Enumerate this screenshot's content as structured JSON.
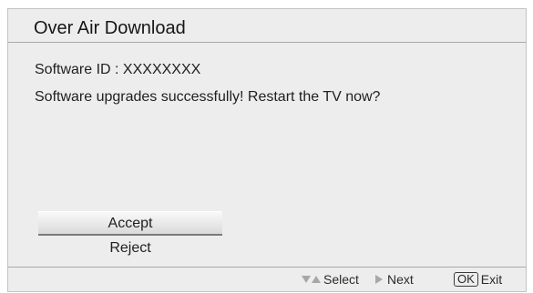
{
  "dialog": {
    "title": "Over Air Download",
    "software_id": "Software ID : XXXXXXXX",
    "message": "Software upgrades successfully! Restart the TV now?"
  },
  "buttons": {
    "accept_label": "Accept",
    "reject_label": "Reject",
    "selected": "Accept"
  },
  "footer": {
    "select_label": "Select",
    "next_label": "Next",
    "ok_key": "OK",
    "exit_label": "Exit",
    "icons": {
      "select": [
        "down-triangle-icon",
        "up-triangle-icon"
      ],
      "next": "right-triangle-icon",
      "exit": "ok-key-icon"
    }
  },
  "colors": {
    "dialog_background": "#ededed",
    "divider": "#a9a9a9",
    "text": "#1f1f1f",
    "hint_icon": "#a7a7a7"
  }
}
